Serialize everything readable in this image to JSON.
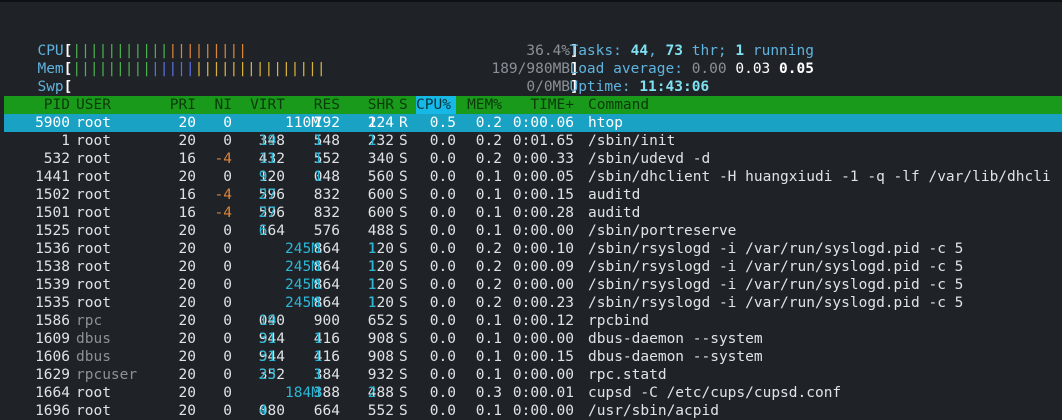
{
  "meters": {
    "cpu": {
      "label": "CPU",
      "percent": "36.4%",
      "bar_fraction": 0.364
    },
    "mem": {
      "label": "Mem",
      "text": "189/980MB",
      "used_fraction": 0.193
    },
    "swp": {
      "label": "Swp",
      "text": "0/0MB",
      "used_fraction": 0
    }
  },
  "tasks": {
    "label": "Tasks:",
    "count": "44",
    "sep": ", ",
    "threads": "73",
    "thr_label": " thr; ",
    "running": "1",
    "running_label": " running"
  },
  "load": {
    "label": "Load average:",
    "l1": "0.00",
    "l5": "0.03",
    "l15": "0.05"
  },
  "uptime": {
    "label": "Uptime:",
    "value": "11:43:06"
  },
  "header": {
    "pid": "PID",
    "user": "USER",
    "pri": "PRI",
    "ni": "NI",
    "virt": "VIRT",
    "res": "RES",
    "shr": "SHR",
    "s": "S",
    "cpu": "CPU%",
    "mem": "MEM%",
    "time": "TIME+",
    "command": "Command"
  },
  "processes": [
    {
      "pid": "5900",
      "user": "root",
      "pri": "20",
      "ni": "0",
      "virt": "110M",
      "res": "1792",
      "shr": "1224",
      "s": "R",
      "cpu": "0.5",
      "mem": "0.2",
      "time": "0:00.06",
      "cmd": "htop"
    },
    {
      "pid": "1",
      "user": "root",
      "pri": "20",
      "ni": "0",
      "virt": "19348",
      "res": "1548",
      "shr": "1232",
      "s": "S",
      "cpu": "0.0",
      "mem": "0.2",
      "time": "0:01.65",
      "cmd": "/sbin/init"
    },
    {
      "pid": "532",
      "user": "root",
      "pri": "16",
      "ni": "-4",
      "virt": "11432",
      "res": "1552",
      "shr": "340",
      "s": "S",
      "cpu": "0.0",
      "mem": "0.2",
      "time": "0:00.33",
      "cmd": "/sbin/udevd -d"
    },
    {
      "pid": "1441",
      "user": "root",
      "pri": "20",
      "ni": "0",
      "virt": "9120",
      "res": "1048",
      "shr": "560",
      "s": "S",
      "cpu": "0.0",
      "mem": "0.1",
      "time": "0:00.05",
      "cmd": "/sbin/dhclient -H huangxiudi -1 -q -lf /var/lib/dhcli"
    },
    {
      "pid": "1502",
      "user": "root",
      "pri": "16",
      "ni": "-4",
      "virt": "27596",
      "res": "832",
      "shr": "600",
      "s": "S",
      "cpu": "0.0",
      "mem": "0.1",
      "time": "0:00.15",
      "cmd": "auditd"
    },
    {
      "pid": "1501",
      "user": "root",
      "pri": "16",
      "ni": "-4",
      "virt": "27596",
      "res": "832",
      "shr": "600",
      "s": "S",
      "cpu": "0.0",
      "mem": "0.1",
      "time": "0:00.28",
      "cmd": "auditd"
    },
    {
      "pid": "1525",
      "user": "root",
      "pri": "20",
      "ni": "0",
      "virt": "6164",
      "res": "576",
      "shr": "488",
      "s": "S",
      "cpu": "0.0",
      "mem": "0.1",
      "time": "0:00.00",
      "cmd": "/sbin/portreserve"
    },
    {
      "pid": "1536",
      "user": "root",
      "pri": "20",
      "ni": "0",
      "virt": "245M",
      "res": "1864",
      "shr": "1120",
      "s": "S",
      "cpu": "0.0",
      "mem": "0.2",
      "time": "0:00.10",
      "cmd": "/sbin/rsyslogd -i /var/run/syslogd.pid -c 5"
    },
    {
      "pid": "1538",
      "user": "root",
      "pri": "20",
      "ni": "0",
      "virt": "245M",
      "res": "1864",
      "shr": "1120",
      "s": "S",
      "cpu": "0.0",
      "mem": "0.2",
      "time": "0:00.09",
      "cmd": "/sbin/rsyslogd -i /var/run/syslogd.pid -c 5"
    },
    {
      "pid": "1539",
      "user": "root",
      "pri": "20",
      "ni": "0",
      "virt": "245M",
      "res": "1864",
      "shr": "1120",
      "s": "S",
      "cpu": "0.0",
      "mem": "0.2",
      "time": "0:00.00",
      "cmd": "/sbin/rsyslogd -i /var/run/syslogd.pid -c 5"
    },
    {
      "pid": "1535",
      "user": "root",
      "pri": "20",
      "ni": "0",
      "virt": "245M",
      "res": "1864",
      "shr": "1120",
      "s": "S",
      "cpu": "0.0",
      "mem": "0.2",
      "time": "0:00.23",
      "cmd": "/sbin/rsyslogd -i /var/run/syslogd.pid -c 5"
    },
    {
      "pid": "1586",
      "user": "rpc",
      "pri": "20",
      "ni": "0",
      "virt": "19040",
      "res": "900",
      "shr": "652",
      "s": "S",
      "cpu": "0.0",
      "mem": "0.1",
      "time": "0:00.12",
      "cmd": "rpcbind"
    },
    {
      "pid": "1609",
      "user": "dbus",
      "pri": "20",
      "ni": "0",
      "virt": "31944",
      "res": "1416",
      "shr": "908",
      "s": "S",
      "cpu": "0.0",
      "mem": "0.1",
      "time": "0:00.00",
      "cmd": "dbus-daemon --system"
    },
    {
      "pid": "1606",
      "user": "dbus",
      "pri": "20",
      "ni": "0",
      "virt": "31944",
      "res": "1416",
      "shr": "908",
      "s": "S",
      "cpu": "0.0",
      "mem": "0.1",
      "time": "0:00.15",
      "cmd": "dbus-daemon --system"
    },
    {
      "pid": "1629",
      "user": "rpcuser",
      "pri": "20",
      "ni": "0",
      "virt": "23352",
      "res": "1384",
      "shr": "932",
      "s": "S",
      "cpu": "0.0",
      "mem": "0.1",
      "time": "0:00.00",
      "cmd": "rpc.statd"
    },
    {
      "pid": "1664",
      "user": "root",
      "pri": "20",
      "ni": "0",
      "virt": "184M",
      "res": "3388",
      "shr": "2488",
      "s": "S",
      "cpu": "0.0",
      "mem": "0.3",
      "time": "0:00.01",
      "cmd": "cupsd -C /etc/cups/cupsd.conf"
    },
    {
      "pid": "1696",
      "user": "root",
      "pri": "20",
      "ni": "0",
      "virt": "4080",
      "res": "664",
      "shr": "552",
      "s": "S",
      "cpu": "0.0",
      "mem": "0.1",
      "time": "0:00.00",
      "cmd": "/usr/sbin/acpid"
    }
  ],
  "colors": {
    "header_bg": "#1a9a1a",
    "selected_bg": "#1aa2c4",
    "sort_bg": "#16b9e6",
    "cpu_bar_low": "#4caf50",
    "cpu_bar_high": "#d9853b",
    "mem_bar_used": "#4caf50",
    "mem_bar_buffers": "#5b6ee0",
    "mem_bar_cache": "#d9b23b"
  }
}
